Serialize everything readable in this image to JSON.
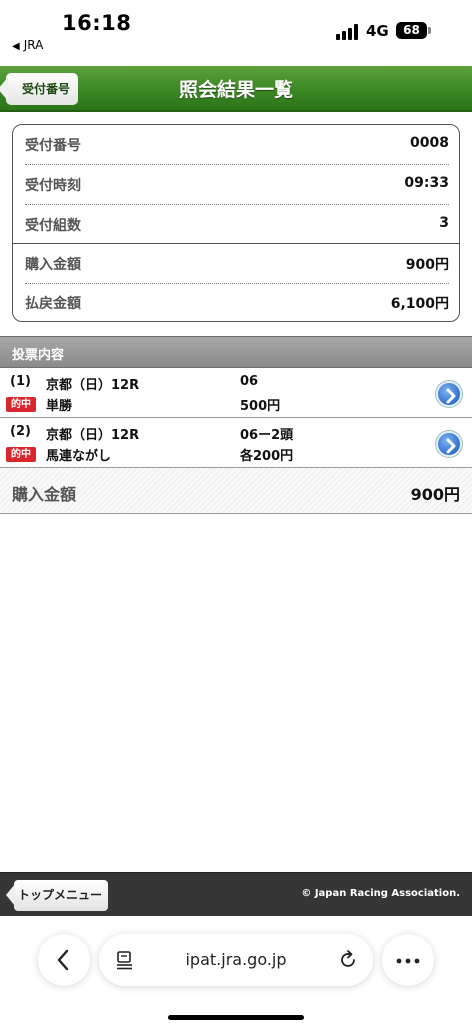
{
  "status": {
    "time": "16:18",
    "back_app": "JRA",
    "network": "4G",
    "battery": "68"
  },
  "header": {
    "back_label": "受付番号",
    "title": "照会結果一覧"
  },
  "receipt": {
    "rows": [
      {
        "label": "受付番号",
        "value": "0008"
      },
      {
        "label": "受付時刻",
        "value": "09:33"
      },
      {
        "label": "受付組数",
        "value": "3"
      },
      {
        "label": "購入金額",
        "value": "900円"
      },
      {
        "label": "払戻金額",
        "value": "6,100円"
      }
    ]
  },
  "section": {
    "title": "投票内容"
  },
  "bets": [
    {
      "num": "(1)",
      "race": "京都（日）12R",
      "hit": "的中",
      "type": "単勝",
      "combo": "06",
      "amount": "500円"
    },
    {
      "num": "(2)",
      "race": "京都（日）12R",
      "hit": "的中",
      "type": "馬連ながし",
      "combo": "06ー2頭",
      "amount": "各200円"
    }
  ],
  "total": {
    "label": "購入金額",
    "value": "900円"
  },
  "footer": {
    "top_menu": "トップメニュー",
    "copyright": "© Japan Racing Association."
  },
  "browser": {
    "url": "ipat.jra.go.jp"
  },
  "icons": {
    "back": "chevron-left-icon",
    "reader": "reader-icon",
    "reload": "reload-icon",
    "more": "more-icon",
    "bet_arrow": "chevron-right-circle-icon"
  },
  "colors": {
    "header_green": "#3e8a26",
    "hit_red": "#d9262f",
    "arrow_blue": "#2f6fcf",
    "footer_dark": "#363636"
  }
}
